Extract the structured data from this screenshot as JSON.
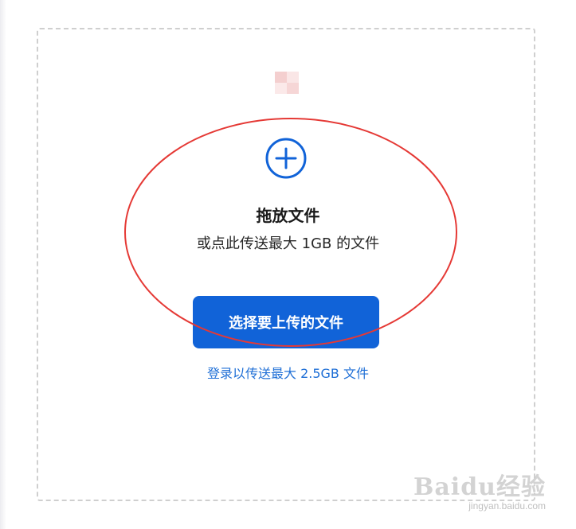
{
  "upload": {
    "title": "拖放文件",
    "subtitle": "或点此传送最大 1GB 的文件",
    "button_label": "选择要上传的文件",
    "login_link": "登录以传送最大 2.5GB 文件"
  },
  "watermark": {
    "logo": "Baidu经验",
    "url": "jingyan.baidu.com"
  },
  "icons": {
    "add": "plus-circle-icon",
    "thumbnail": "image-placeholder-icon"
  },
  "colors": {
    "accent": "#1163d8",
    "link": "#1f6fd6",
    "annotation": "#e53935",
    "dashed_border": "#cfcfcf"
  }
}
